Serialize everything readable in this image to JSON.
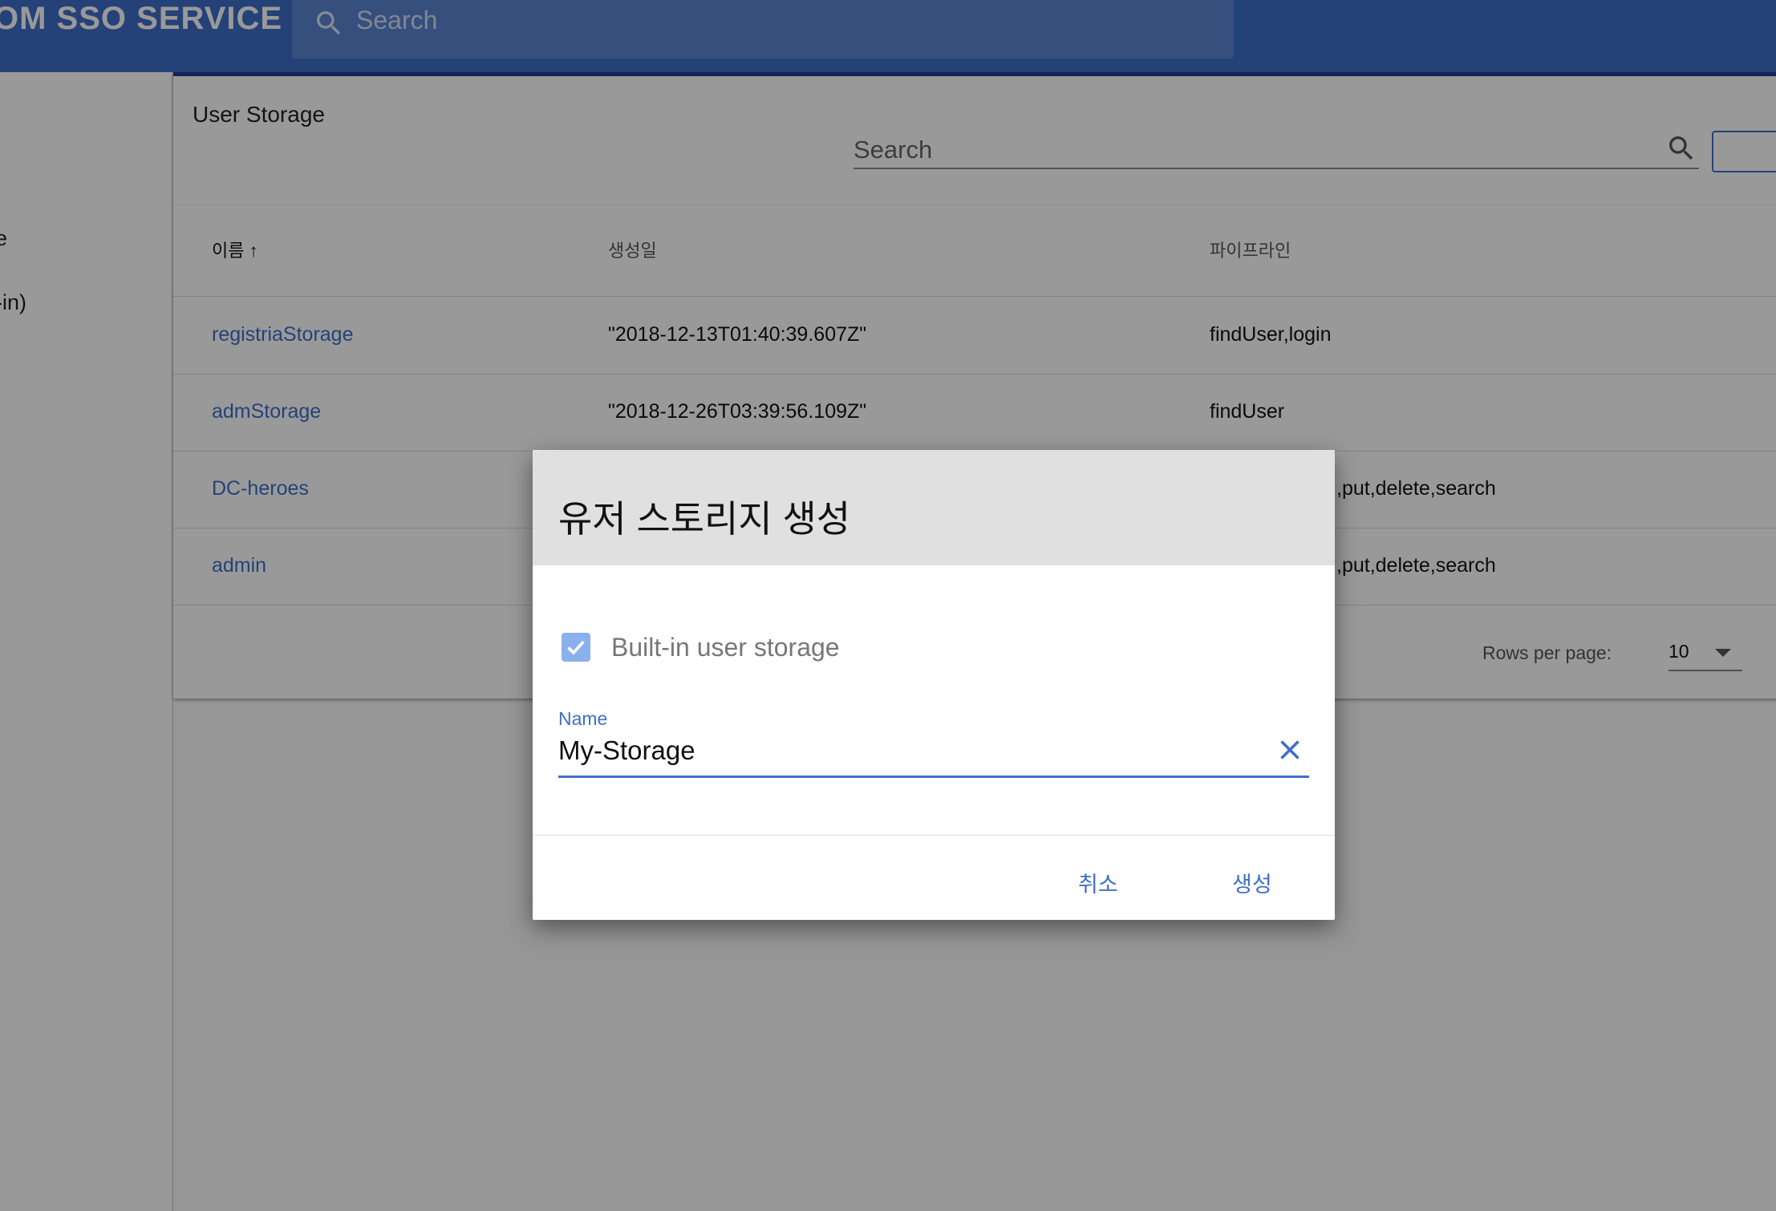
{
  "appbar": {
    "brand": "OM SSO SERVICE",
    "search_placeholder": "Search"
  },
  "sidenav": {
    "items": [
      {
        "label": "e"
      },
      {
        "label": "-in)"
      }
    ]
  },
  "card": {
    "title": "User Storage",
    "search_placeholder": "Search",
    "columns": [
      {
        "label": "이름 ↑"
      },
      {
        "label": "생성일"
      },
      {
        "label": "파이프라인"
      }
    ],
    "rows": [
      {
        "name": "registriaStorage",
        "created": "\"2018-12-13T01:40:39.607Z\"",
        "pipeline": "findUser,login"
      },
      {
        "name": "admStorage",
        "created": "\"2018-12-26T03:39:56.109Z\"",
        "pipeline": "findUser"
      },
      {
        "name": "DC-heroes",
        "created": "",
        "pipeline": ",put,delete,search"
      },
      {
        "name": "admin",
        "created": "",
        "pipeline": ",put,delete,search"
      }
    ],
    "rows_per_page_label": "Rows per page:",
    "rows_per_page_value": "10"
  },
  "dialog": {
    "title": "유저 스토리지 생성",
    "builtin_label": "Built-in user storage",
    "builtin_checked": true,
    "name_label": "Name",
    "name_value": "My-Storage",
    "cancel_label": "취소",
    "create_label": "생성",
    "accent": "#3f6fc8"
  }
}
